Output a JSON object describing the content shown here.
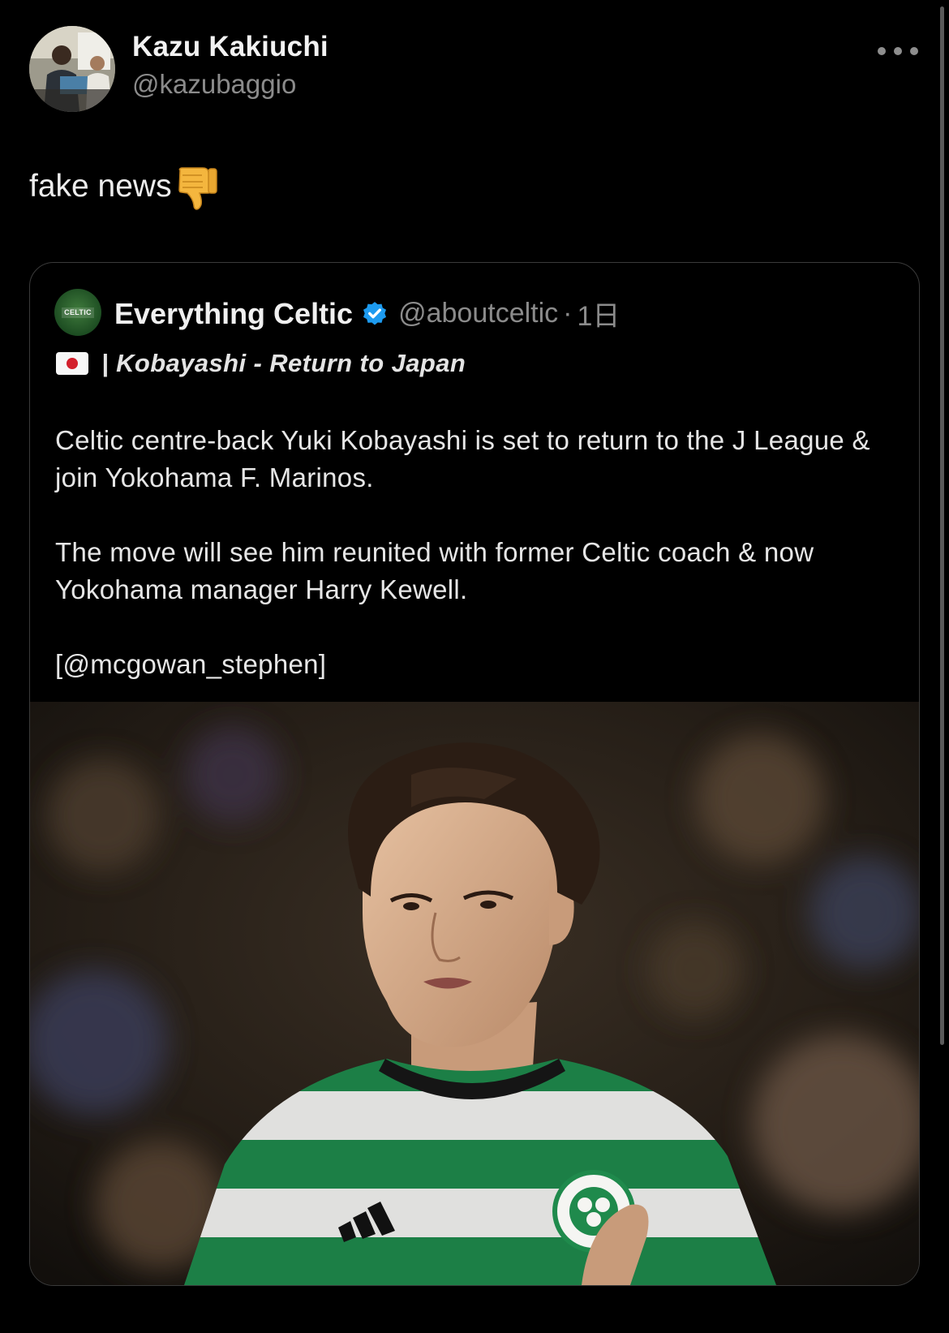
{
  "post": {
    "author": {
      "display_name": "Kazu Kakiuchi",
      "handle": "@kazubaggio",
      "avatar_icon": "user-avatar"
    },
    "more_icon": "more-horizontal-icon",
    "text": "fake news",
    "emoji": "thumbs-down"
  },
  "quote": {
    "author": {
      "display_name": "Everything Celtic",
      "handle": "@aboutceltic",
      "separator": "·",
      "time": "1日",
      "verified": true,
      "avatar_label": "CELTIC"
    },
    "headline_flag": "japan-flag",
    "headline": "| Kobayashi - Return to Japan",
    "paragraphs": [
      "Celtic centre-back Yuki Kobayashi is set to return to the J League & join Yokohama F. Marinos.",
      "The move will see him reunited with former Celtic coach & now Yokohama manager Harry Kewell.",
      "[@mcgowan_stephen]"
    ],
    "media": "photo-footballer-celtic-kit"
  },
  "colors": {
    "background": "#000000",
    "text_primary": "#e7e9ea",
    "text_secondary": "#8b8b8b",
    "verified": "#1d9bf0",
    "card_border": "#3a3a3a"
  }
}
